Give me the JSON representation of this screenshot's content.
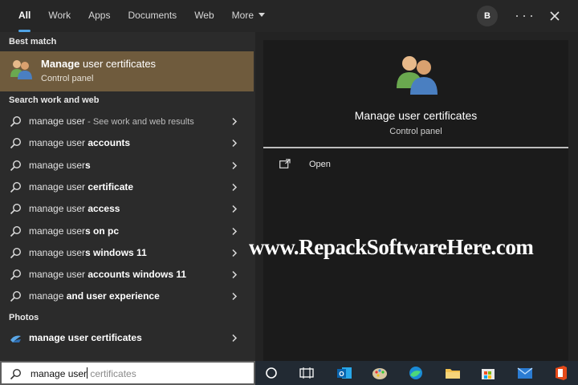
{
  "tabs": [
    {
      "label": "All",
      "active": true
    },
    {
      "label": "Work",
      "active": false
    },
    {
      "label": "Apps",
      "active": false
    },
    {
      "label": "Documents",
      "active": false
    },
    {
      "label": "Web",
      "active": false
    },
    {
      "label": "More",
      "active": false
    }
  ],
  "header": {
    "avatar_initial": "B",
    "more_options_icon": "ellipsis-icon",
    "close_icon": "close-icon"
  },
  "left": {
    "best_match_heading": "Best match",
    "best_match": {
      "title_prefix": "Manage",
      "title_rest": " user certificates",
      "subtitle": "Control panel",
      "icon": "users-icon"
    },
    "search_web_heading": "Search work and web",
    "suggestions": [
      {
        "typed": "manage user",
        "rest": "",
        "hint": " - See work and web results"
      },
      {
        "typed": "manage user",
        "rest": " accounts",
        "hint": ""
      },
      {
        "typed": "manage user",
        "rest": "s",
        "hint": ""
      },
      {
        "typed": "manage user",
        "rest": " certificate",
        "hint": ""
      },
      {
        "typed": "manage user",
        "rest": " access",
        "hint": ""
      },
      {
        "typed": "manage user",
        "rest": "s on pc",
        "hint": ""
      },
      {
        "typed": "manage user",
        "rest": "s windows 11",
        "hint": ""
      },
      {
        "typed": "manage user",
        "rest": " accounts windows 11",
        "hint": ""
      },
      {
        "typed": "manage",
        "rest": " and user experience",
        "hint": ""
      }
    ],
    "photos_heading": "Photos",
    "photo_result": {
      "text": "manage user certificates",
      "icon": "photos-app-icon"
    }
  },
  "preview": {
    "title": "Manage user certificates",
    "subtitle": "Control panel",
    "actions": [
      {
        "label": "Open",
        "icon": "open-window-icon"
      }
    ]
  },
  "watermark": "www.RepackSoftwareHere.com",
  "search": {
    "typed": "manage user",
    "suggestion": " certificates"
  },
  "taskbar": {
    "icons": [
      "search-circle-icon",
      "task-view-icon",
      "outlook-icon",
      "paint-icon",
      "edge-icon",
      "file-explorer-icon",
      "store-icon",
      "mail-icon",
      "office-icon"
    ]
  },
  "colors": {
    "accent": "#4fa3e6",
    "best_match_bg": "#6f5b3d",
    "panel_bg": "#2b2b2b",
    "taskbar_bg": "#222a33"
  }
}
